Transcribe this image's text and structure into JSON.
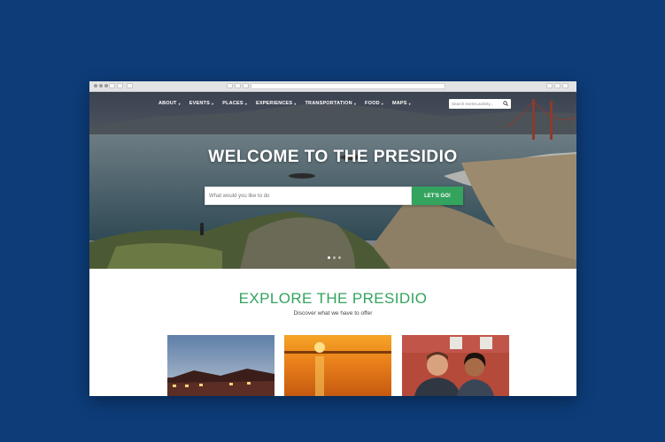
{
  "nav": {
    "items": [
      {
        "label": "ABOUT"
      },
      {
        "label": "EVENTS"
      },
      {
        "label": "PLACES"
      },
      {
        "label": "EXPERIENCES"
      },
      {
        "label": "TRANSPORTATION"
      },
      {
        "label": "FOOD"
      },
      {
        "label": "MAPS"
      }
    ],
    "search_placeholder": "Search events,activity..."
  },
  "hero": {
    "title": "WELCOME TO THE PRESIDIO",
    "search_placeholder": "What would you like to do",
    "button_label": "LET'S GO!",
    "slide_count": 3,
    "active_slide": 1
  },
  "explore": {
    "title": "EXPLORE THE PRESIDIO",
    "subtitle": "Discover what we have to offer"
  },
  "colors": {
    "background": "#0d3c78",
    "accent_green": "#33a35e"
  },
  "cards": [
    {
      "name": "building-at-dusk"
    },
    {
      "name": "sunset-over-water"
    },
    {
      "name": "smiling-couple"
    }
  ]
}
